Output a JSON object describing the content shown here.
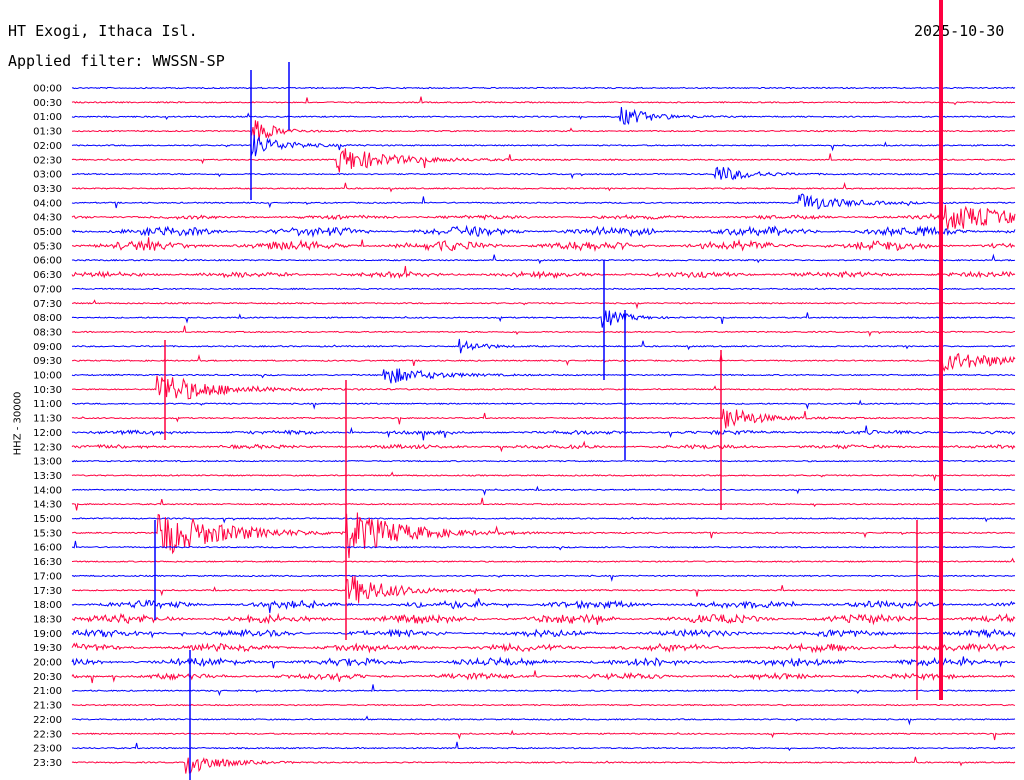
{
  "header": {
    "station": "HT Exogi, Ithaca Isl.",
    "filter": "Applied filter: WWSSN-SP",
    "date": "2025-10-30"
  },
  "chart_data": {
    "type": "line",
    "title": "HT Exogi, Ithaca Isl.",
    "subtitle": "Applied filter: WWSSN-SP",
    "ylabel": "HHZ - 30000",
    "xlabel": "",
    "row_labels": [
      "00:00",
      "00:30",
      "01:00",
      "01:30",
      "02:00",
      "02:30",
      "03:00",
      "03:30",
      "04:00",
      "04:30",
      "05:00",
      "05:30",
      "06:00",
      "06:30",
      "07:00",
      "07:30",
      "08:00",
      "08:30",
      "09:00",
      "09:30",
      "10:00",
      "10:30",
      "11:00",
      "11:30",
      "12:00",
      "12:30",
      "13:00",
      "13:30",
      "14:00",
      "14:30",
      "15:00",
      "15:30",
      "16:00",
      "16:30",
      "17:00",
      "17:30",
      "18:00",
      "18:30",
      "19:00",
      "19:30",
      "20:00",
      "20:30",
      "21:00",
      "21:30",
      "22:00",
      "22:30",
      "23:00",
      "23:30"
    ],
    "series": [
      {
        "color": "#0000ff"
      },
      {
        "color": "#ff0040"
      }
    ],
    "grid": false
  }
}
